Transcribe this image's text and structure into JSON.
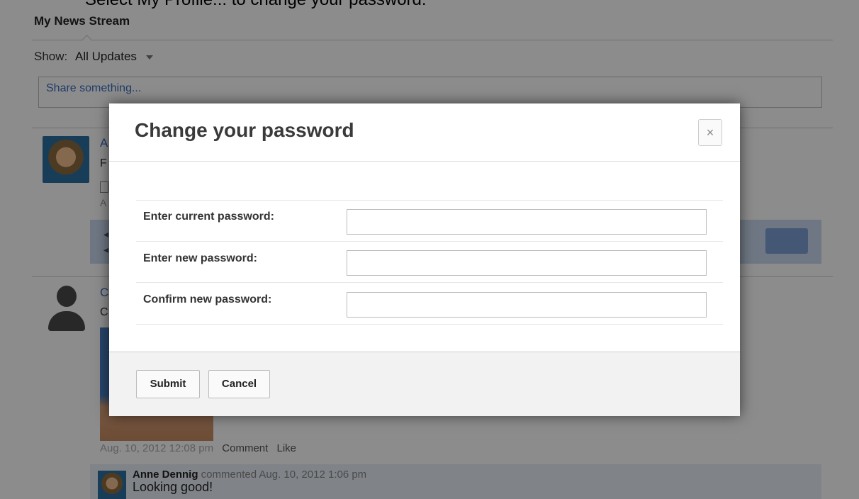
{
  "instruction_clip": "Select My Profile... to change your password.",
  "stream": {
    "tab_label": "My News Stream",
    "show_label": "Show:",
    "filter_value": "All Updates",
    "share_placeholder": "Share something..."
  },
  "posts": [
    {
      "initial": "A",
      "text_initial": "F",
      "sub": "A"
    },
    {
      "initial": "C",
      "text_initial": "C"
    }
  ],
  "meta": {
    "date": "Aug. 10, 2012 12:08 pm",
    "comment_link": "Comment",
    "like_link": "Like"
  },
  "comment": {
    "author": "Anne Dennig",
    "action": "commented",
    "timestamp": "Aug. 10, 2012 1:06 pm",
    "text": "Looking good!"
  },
  "dialog": {
    "title": "Change your password",
    "close_glyph": "×",
    "fields": [
      {
        "label": "Enter current password:",
        "value": ""
      },
      {
        "label": "Enter new password:",
        "value": ""
      },
      {
        "label": "Confirm new password:",
        "value": ""
      }
    ],
    "submit_label": "Submit",
    "cancel_label": "Cancel"
  },
  "icons": {
    "close": "close-icon",
    "dropdown": "chevron-down-icon",
    "avatar": "avatar-icon"
  },
  "colors": {
    "link": "#3b6dbf",
    "overlay": "rgba(0,0,0,0.45)",
    "panel": "#c9d9ef"
  }
}
